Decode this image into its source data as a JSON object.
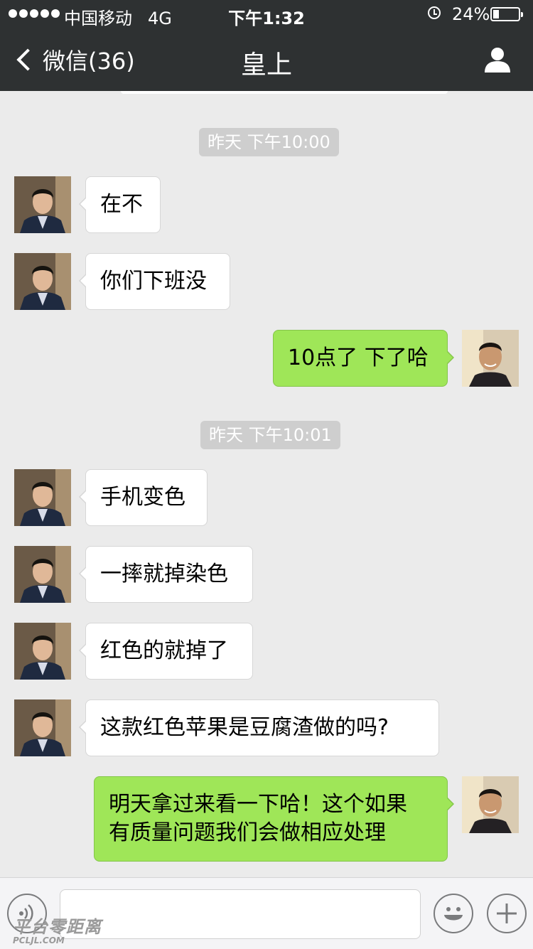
{
  "status_bar": {
    "carrier": "中国移动",
    "network": "4G",
    "time": "下午1:32",
    "battery": "24%",
    "battery_level": 0.24
  },
  "nav": {
    "back_label": "微信(36)",
    "title": "皇上"
  },
  "timestamps": [
    "昨天  下午10:00",
    "昨天  下午10:01"
  ],
  "messages": [
    {
      "side": "in",
      "text": "在不"
    },
    {
      "side": "in",
      "text": "你们下班没"
    },
    {
      "side": "out",
      "text": "10点了  下了哈"
    },
    {
      "side": "in",
      "text": "手机变色"
    },
    {
      "side": "in",
      "text": "一摔就掉染色"
    },
    {
      "side": "in",
      "text": "红色的就掉了"
    },
    {
      "side": "in",
      "text": "这款红色苹果是豆腐渣做的吗?"
    },
    {
      "side": "out",
      "text_lines": [
        "明天拿过来看一下哈！这个如果",
        "有质量问题我们会做相应处理"
      ]
    }
  ],
  "watermark": {
    "line1": "平台零距离",
    "line2": "PCLJL.COM"
  },
  "colors": {
    "nav_bg": "#2e3132",
    "chat_bg": "#ebebeb",
    "outgoing_bubble": "#9fe658",
    "incoming_bubble": "#ffffff",
    "timestamp_bg": "#cecece"
  },
  "icons": [
    "chevron-left-icon",
    "person-icon",
    "voice-icon",
    "emoji-icon",
    "plus-icon"
  ]
}
